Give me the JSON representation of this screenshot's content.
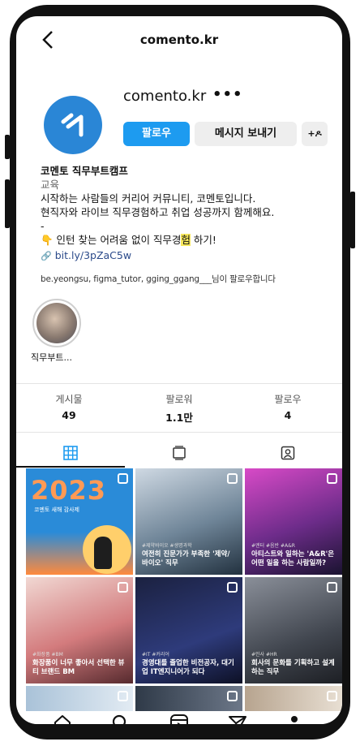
{
  "header": {
    "handle": "comento.kr"
  },
  "profile": {
    "username": "comento.kr",
    "more": "•••",
    "buttons": {
      "follow": "팔로우",
      "message": "메시지 보내기",
      "add_person": "+ዶ"
    }
  },
  "bio": {
    "name": "코멘토 직무부트캠프",
    "category": "교육",
    "line1": "시작하는 사람들의 커리어 커뮤니티, 코멘토입니다.",
    "line2": "현직자와 라이브 직무경험하고 취업 성공까지 함께해요.",
    "dash": "-",
    "line3_prefix": "👇 인턴 찾는 어려움 없이 직무경",
    "line3_highlight": "험",
    "line3_suffix": " 하기!",
    "link": "bit.ly/3pZaC5w",
    "followed_by": "be.yeongsu, figma_tutor, gging_ggang___님이 팔로우합니다"
  },
  "highlight": {
    "label": "직무부트..."
  },
  "stats": [
    {
      "label": "게시물",
      "value": "49"
    },
    {
      "label": "팔로워",
      "value": "1.1만"
    },
    {
      "label": "팔로우",
      "value": "4"
    }
  ],
  "posts": {
    "p1": {
      "year": "2023",
      "sub": "코멘토 새해 감사제"
    },
    "p2": {
      "tag": "#제약바이오 #생명과학",
      "caption": "여전히 진문가가 부족한 '제약/바이오' 직무"
    },
    "p3": {
      "tag": "#엔터 #음반 #A&R",
      "caption": "아티스트와 일하는 'A&R'은 어떤 일을 하는 사람일까?"
    },
    "p4": {
      "tag": "#화장품 #BM",
      "caption": "화장품이 너무 좋아서 선택한 뷰티 브랜드 BM"
    },
    "p5": {
      "tag": "#IT #커리어",
      "caption": "경영대를 졸업한 비전공자, 대기업 IT엔지니어가 되다"
    },
    "p6": {
      "tag": "#인사 #HR",
      "caption": "회사의 문화를 기획하고 설계하는 직무"
    }
  },
  "colors": {
    "follow": "#1d9bf0",
    "brand": "#2a86d6",
    "link": "#2b4a8a"
  },
  "icons": {
    "back": "chevron-left-icon",
    "grid": "grid-icon",
    "reels": "reels-tab-icon",
    "tagged": "tagged-icon",
    "home": "home-icon",
    "search": "search-icon",
    "video": "reels-icon",
    "send": "send-icon",
    "profile": "profile-icon"
  }
}
